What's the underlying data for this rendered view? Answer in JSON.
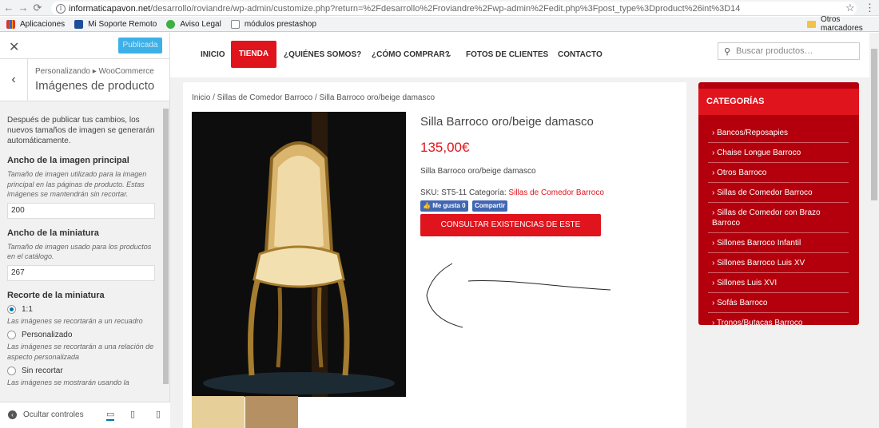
{
  "browser": {
    "url_domain": "informaticapavon.net",
    "url_path": "/desarrollo/roviandre/wp-admin/customize.php?return=%2Fdesarrollo%2Froviandre%2Fwp-admin%2Fedit.php%3Fpost_type%3Dproduct%26int%3D14",
    "bookmarks": [
      "Aplicaciones",
      "Mi Soporte Remoto",
      "Aviso Legal",
      "módulos prestashop"
    ],
    "other_bookmarks": "Otros marcadores"
  },
  "customizer": {
    "publish_label": "Publicada",
    "breadcrumb": "Personalizando ▸ WooCommerce",
    "title": "Imágenes de producto",
    "notice": "Después de publicar tus cambios, los nuevos tamaños de imagen se generarán automáticamente.",
    "main_width_label": "Ancho de la imagen principal",
    "main_width_desc": "Tamaño de imagen utilizado para la imagen principal en las páginas de producto. Estas imágenes se mantendrán sin recortar.",
    "main_width_value": "200",
    "thumb_width_label": "Ancho de la miniatura",
    "thumb_width_desc": "Tamaño de imagen usado para los productos en el catálogo.",
    "thumb_width_value": "267",
    "crop_label": "Recorte de la miniatura",
    "crop_options": [
      {
        "label": "1:1",
        "desc": "Las imágenes se recortarán a un recuadro",
        "selected": true
      },
      {
        "label": "Personalizado",
        "desc": "Las imágenes se recortarán a una relación de aspecto personalizada",
        "selected": false
      },
      {
        "label": "Sin recortar",
        "desc": "Las imágenes se mostrarán usando la",
        "selected": false
      }
    ],
    "hide_controls": "Ocultar controles"
  },
  "site": {
    "nav": [
      "INICIO",
      "TIENDA",
      "¿QUIÉNES SOMOS?",
      "¿CÓMO COMPRAR?",
      "FOTOS DE CLIENTES",
      "CONTACTO"
    ],
    "search_placeholder": "Buscar productos…",
    "breadcrumb": "Inicio / Sillas de Comedor Barroco / Silla Barroco oro/beige damasco",
    "product_title": "Silla Barroco oro/beige damasco",
    "price": "135,00€",
    "short_desc": "Silla Barroco oro/beige damasco",
    "sku_label": "SKU: ST5-11 Categoría: ",
    "category": "Sillas de Comedor Barroco",
    "fb_like": "Me gusta 0",
    "fb_share": "Compartir",
    "consult_button": "CONSULTAR EXISTENCIAS DE ESTE PRODUCTO",
    "categories_title": "CATEGORÍAS",
    "categories": [
      "Bancos/Reposapies",
      "Chaise Longue Barroco",
      "Otros Barroco",
      "Sillas de Comedor Barroco",
      "Sillas de Comedor con Brazo Barroco",
      "Sillones Barroco Infantil",
      "Sillones Barroco Luis XV",
      "Sillones Luis XVI",
      "Sofás Barroco",
      "Tronos/Butacas Barroco"
    ]
  },
  "colors": {
    "accent": "#e0141d",
    "sidebar": "#b4000c",
    "publish": "#3eb0e8"
  }
}
